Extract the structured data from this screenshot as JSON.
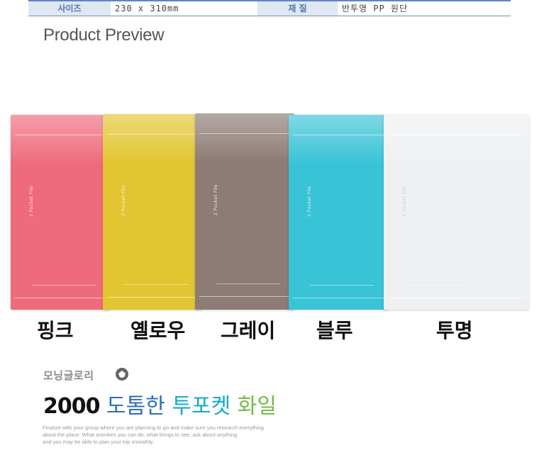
{
  "spec": {
    "size_label": "사이즈",
    "size_value": "230 x 310mm",
    "material_label": "재   질",
    "material_value": "반투명 PP 원단"
  },
  "preview_title": "Product Preview",
  "folders": [
    {
      "name": "핑크",
      "color": "#ee6b7c"
    },
    {
      "name": "옐로우",
      "color": "#e3c531"
    },
    {
      "name": "그레이",
      "color": "#8d7b75"
    },
    {
      "name": "블루",
      "color": "#39c3d6"
    },
    {
      "name": "투명",
      "color": "#eef0f2"
    }
  ],
  "folder_spine_text": "2 Pocket File",
  "brand": {
    "name": "모닝글로리"
  },
  "headline": {
    "number": "2000",
    "word1": "도톰한",
    "word2": "투포켓",
    "word3": "화일"
  },
  "description": [
    "Finalize with your group where you are planning to go and make sure you research everything",
    "about the place. What activities you can do, what things to see, ask about anything",
    "and you may be able to plan your trip smoothly."
  ]
}
